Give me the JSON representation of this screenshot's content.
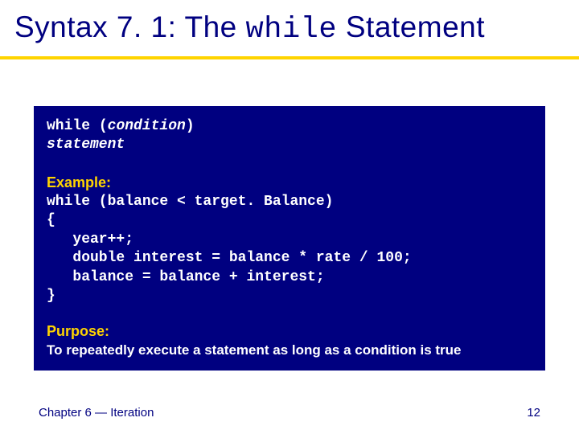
{
  "title": {
    "prefix": "Syntax 7. 1: The ",
    "mono": "while",
    "suffix": " Statement"
  },
  "syntax": {
    "keyword": "while",
    "open": "(",
    "condition": "condition",
    "close": ")",
    "statement_indent": "   ",
    "statement": "statement"
  },
  "example": {
    "label": "Example:",
    "code": "while (balance < target. Balance)\n{\n   year++;\n   double interest = balance * rate / 100;\n   balance = balance + interest;\n}"
  },
  "purpose": {
    "label": "Purpose:",
    "text": "To repeatedly execute a statement as long as a condition is true"
  },
  "footer": {
    "left": "Chapter 6 — Iteration",
    "page": "12"
  }
}
